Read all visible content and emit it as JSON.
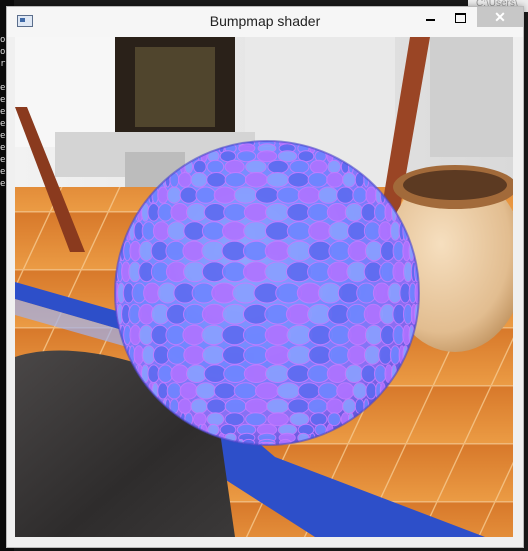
{
  "background_window": {
    "tab_text": "C:\\Users\\",
    "console_lines": [
      "o",
      "o",
      "r",
      "",
      "e",
      "e",
      "e",
      "e",
      "e",
      "e",
      "e",
      "e",
      "e"
    ]
  },
  "window": {
    "title": "Bumpmap shader",
    "controls": {
      "minimize": "minimize",
      "maximize": "maximize",
      "close": "✕"
    }
  },
  "scene": {
    "object": "bump-mapped sphere",
    "sphere_colors": [
      "#6f86ff",
      "#b073ff",
      "#8aa0ff",
      "#5e6bf0"
    ],
    "floor_colors": [
      "#e88a2e",
      "#f3a24a",
      "#c8641c"
    ],
    "tile_blue": "#2d4fc9",
    "pot_color": "#e8c9a1",
    "frame_color": "#8a3a1e"
  }
}
